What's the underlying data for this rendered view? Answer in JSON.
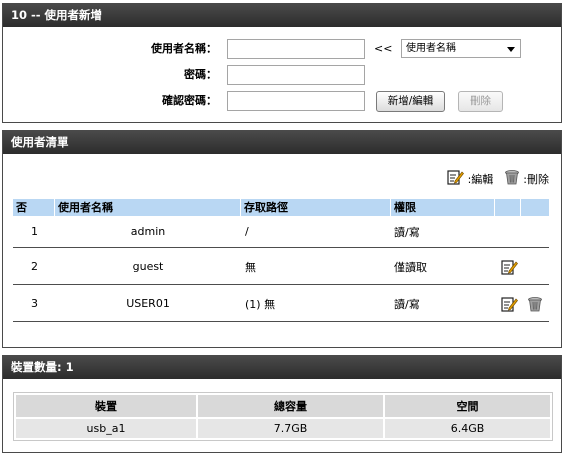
{
  "add_user": {
    "title": "10 -- 使用者新增",
    "username_label": "使用者名稱：",
    "password_label": "密碼：",
    "confirm_label": "確認密碼：",
    "username_value": "",
    "password_value": "",
    "confirm_value": "",
    "arrows": "<<",
    "select_value": "使用者名稱",
    "add_edit_button": "新增/編輯",
    "delete_button": "刪除"
  },
  "user_list": {
    "title": "使用者清單",
    "legend_edit": ":編輯",
    "legend_delete": ":刪除",
    "columns": [
      "否",
      "使用者名稱",
      "存取路徑",
      "權限"
    ],
    "rows": [
      {
        "no": "1",
        "name": "admin",
        "path": "/",
        "perm": "讀/寫",
        "edit": false,
        "delete": false
      },
      {
        "no": "2",
        "name": "guest",
        "path": "無",
        "perm": "僅讀取",
        "edit": true,
        "delete": false
      },
      {
        "no": "3",
        "name": "USER01",
        "path": "(1) 無",
        "perm": "讀/寫",
        "edit": true,
        "delete": true
      }
    ]
  },
  "devices": {
    "title": "裝置數量: 1",
    "columns": [
      "裝置",
      "總容量",
      "空間"
    ],
    "rows": [
      {
        "device": "usb_a1",
        "capacity": "7.7GB",
        "free": "6.4GB"
      }
    ]
  },
  "colors": {
    "header_bg": "#333333",
    "table_header_bg": "#b9d7f3",
    "edit_icon": "#e6a100",
    "trash_icon": "#8a8a8a"
  },
  "icons": {
    "edit": "edit-icon",
    "delete": "trash-icon",
    "dropdown": "chevron-down-icon"
  }
}
